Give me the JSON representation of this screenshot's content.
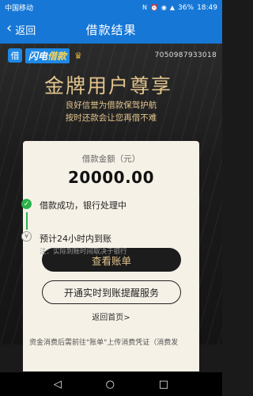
{
  "status_bar": {
    "carrier": "中国移动",
    "battery": "36%",
    "time": "18:49"
  },
  "nav": {
    "back_label": "返回",
    "title": "借款结果"
  },
  "brand": {
    "badge": "借",
    "name_prefix": "闪电",
    "name_highlight": "借款",
    "account_no": "7050987933018"
  },
  "hero": {
    "headline": "金牌用户尊享",
    "sub_line_1": "良好信誉为借款保驾护航",
    "sub_line_2": "按时还款会让您再借不难"
  },
  "card": {
    "amount_label": "借款金额（元）",
    "amount_value": "20000.00",
    "step1_text": "借款成功，银行处理中",
    "step2_text": "预计24小时内到账",
    "step2_note": "注：实际到账时间取决于银行",
    "btn_view_bill": "查看账单",
    "btn_realtime": "开通实时到账提醒服务",
    "home_link": "返回首页>",
    "hint": "资金消费后需前往\"账单\"上传消费凭证（消费发"
  },
  "system_nav": {
    "back": "◁",
    "home": "○",
    "recent": "□"
  }
}
